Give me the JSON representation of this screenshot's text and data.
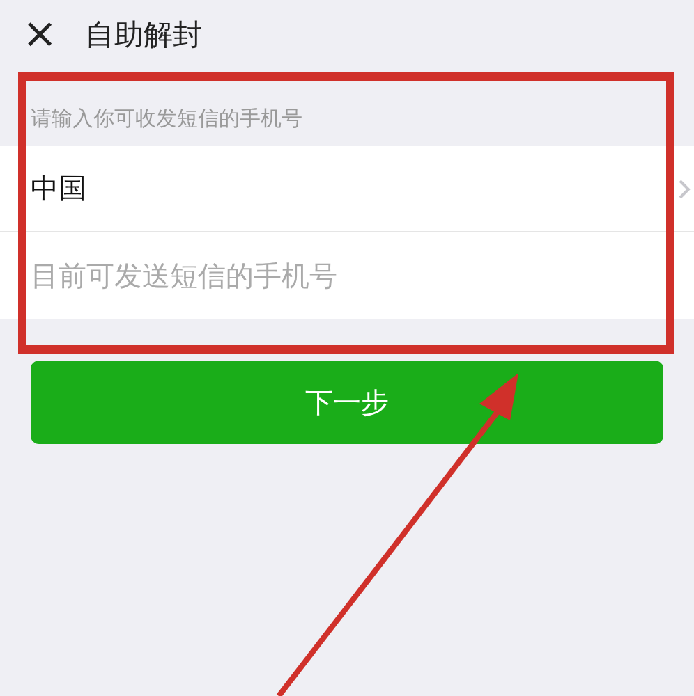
{
  "header": {
    "close_icon": "×",
    "title": "自助解封"
  },
  "form": {
    "section_label": "请输入你可收发短信的手机号",
    "country": "中国",
    "phone": {
      "placeholder": "目前可发送短信的手机号"
    }
  },
  "next_button": "下一步",
  "highlight_box": {
    "color": "#d0302a"
  },
  "pointer_arrow": {
    "color": "#d0302a"
  }
}
